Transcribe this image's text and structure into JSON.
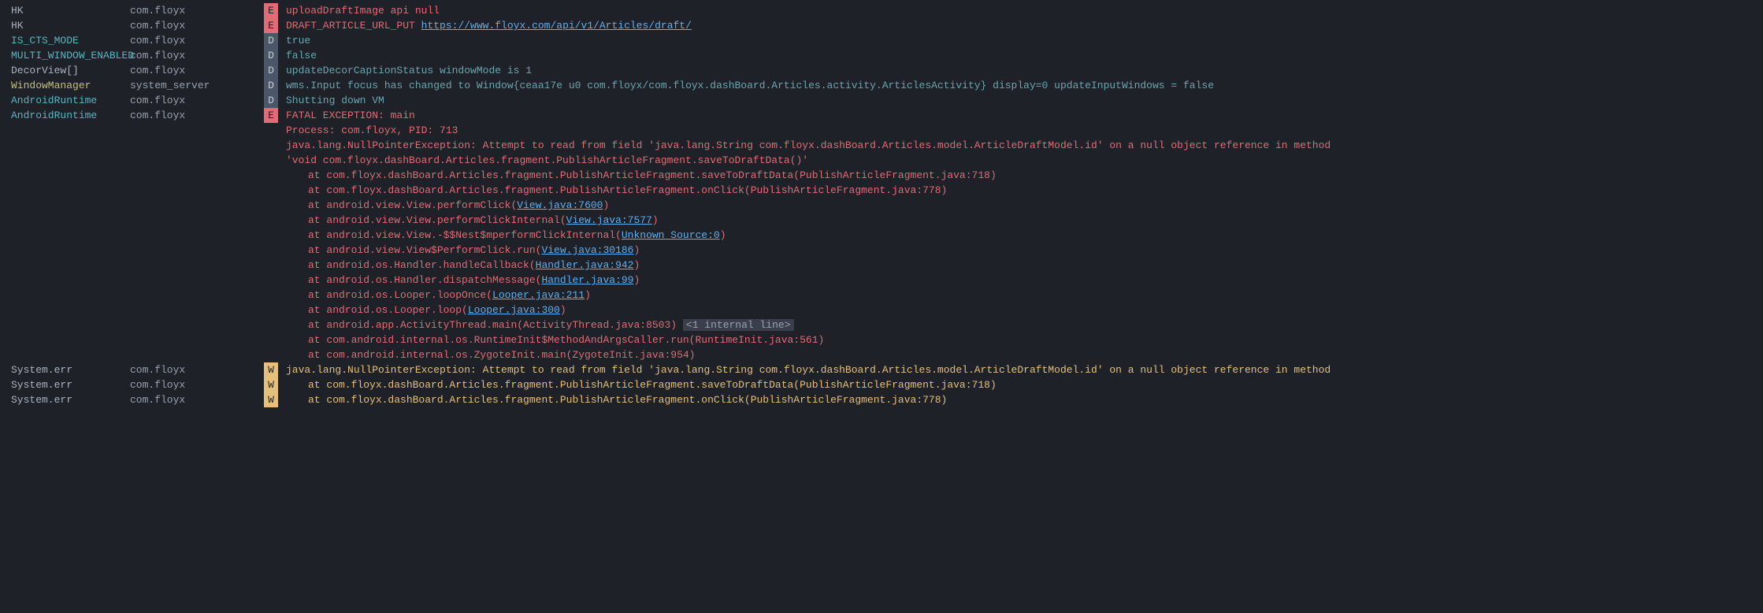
{
  "rows": [
    {
      "tag": "HK",
      "tagClass": "tag-plain",
      "pkg": "com.floyx",
      "level": "E",
      "msg": [
        {
          "t": "uploadDraftImage api null"
        }
      ]
    },
    {
      "tag": "HK",
      "tagClass": "tag-plain",
      "pkg": "com.floyx",
      "level": "E",
      "msg": [
        {
          "t": "DRAFT_ARTICLE_URL_PUT "
        },
        {
          "t": "https://www.floyx.com/api/v1/Articles/draft/",
          "link": true
        }
      ]
    },
    {
      "tag": "IS_CTS_MODE",
      "tagClass": "tag-cyan",
      "pkg": "com.floyx",
      "level": "D",
      "msg": [
        {
          "t": "true"
        }
      ]
    },
    {
      "tag": "MULTI_WINDOW_ENABLED",
      "tagClass": "tag-cyan",
      "pkg": "com.floyx",
      "level": "D",
      "msg": [
        {
          "t": "false"
        }
      ]
    },
    {
      "tag": "DecorView[]",
      "tagClass": "tag-plain",
      "pkg": "com.floyx",
      "level": "D",
      "msg": [
        {
          "t": "updateDecorCaptionStatus windowMode is 1"
        }
      ]
    },
    {
      "tag": "WindowManager",
      "tagClass": "tag-yellow",
      "pkg": "system_server",
      "level": "D",
      "msg": [
        {
          "t": "wms.Input focus has changed to Window{ceaa17e u0 com.floyx/com.floyx.dashBoard.Articles.activity.ArticlesActivity} display=0 updateInputWindows = false"
        }
      ]
    },
    {
      "tag": "AndroidRuntime",
      "tagClass": "tag-cyan",
      "pkg": "com.floyx",
      "level": "D",
      "msg": [
        {
          "t": "Shutting down VM"
        }
      ]
    },
    {
      "tag": "AndroidRuntime",
      "tagClass": "tag-cyan",
      "pkg": "com.floyx",
      "level": "E",
      "msg": [
        {
          "t": "FATAL EXCEPTION: main"
        }
      ]
    },
    {
      "tag": "",
      "pkg": "",
      "level": "",
      "msgClass": "msg-E",
      "msg": [
        {
          "t": "Process: com.floyx, PID: 713"
        }
      ]
    },
    {
      "tag": "",
      "pkg": "",
      "level": "",
      "msgClass": "msg-E",
      "msg": [
        {
          "t": "java.lang.NullPointerException: Attempt to read from field 'java.lang.String com.floyx.dashBoard.Articles.model.ArticleDraftModel.id' on a null object reference in method"
        }
      ]
    },
    {
      "tag": "",
      "pkg": "",
      "level": "",
      "msgClass": "msg-E",
      "msg": [
        {
          "t": "'void com.floyx.dashBoard.Articles.fragment.PublishArticleFragment.saveToDraftData()'"
        }
      ]
    },
    {
      "tag": "",
      "pkg": "",
      "level": "",
      "msgClass": "msg-E",
      "indent": true,
      "msg": [
        {
          "t": "at com.floyx.dashBoard.Articles.fragment.PublishArticleFragment.saveToDraftData(PublishArticleFragment.java:718)"
        }
      ]
    },
    {
      "tag": "",
      "pkg": "",
      "level": "",
      "msgClass": "msg-E",
      "indent": true,
      "msg": [
        {
          "t": "at com.floyx.dashBoard.Articles.fragment.PublishArticleFragment.onClick(PublishArticleFragment.java:778)"
        }
      ]
    },
    {
      "tag": "",
      "pkg": "",
      "level": "",
      "msgClass": "msg-E",
      "indent": true,
      "msg": [
        {
          "t": "at android.view.View.performClick("
        },
        {
          "t": "View.java:7600",
          "link": true
        },
        {
          "t": ")"
        }
      ]
    },
    {
      "tag": "",
      "pkg": "",
      "level": "",
      "msgClass": "msg-E",
      "indent": true,
      "msg": [
        {
          "t": "at android.view.View.performClickInternal("
        },
        {
          "t": "View.java:7577",
          "link": true
        },
        {
          "t": ")"
        }
      ]
    },
    {
      "tag": "",
      "pkg": "",
      "level": "",
      "msgClass": "msg-E",
      "indent": true,
      "msg": [
        {
          "t": "at android.view.View.-$$Nest$mperformClickInternal("
        },
        {
          "t": "Unknown Source:0",
          "link": true
        },
        {
          "t": ")"
        }
      ]
    },
    {
      "tag": "",
      "pkg": "",
      "level": "",
      "msgClass": "msg-E",
      "indent": true,
      "msg": [
        {
          "t": "at android.view.View$PerformClick.run("
        },
        {
          "t": "View.java:30186",
          "link": true
        },
        {
          "t": ")"
        }
      ]
    },
    {
      "tag": "",
      "pkg": "",
      "level": "",
      "msgClass": "msg-E",
      "indent": true,
      "msg": [
        {
          "t": "at android.os.Handler.handleCallback("
        },
        {
          "t": "Handler.java:942",
          "link": true
        },
        {
          "t": ")"
        }
      ]
    },
    {
      "tag": "",
      "pkg": "",
      "level": "",
      "msgClass": "msg-E",
      "indent": true,
      "msg": [
        {
          "t": "at android.os.Handler.dispatchMessage("
        },
        {
          "t": "Handler.java:99",
          "link": true
        },
        {
          "t": ")"
        }
      ]
    },
    {
      "tag": "",
      "pkg": "",
      "level": "",
      "msgClass": "msg-E",
      "indent": true,
      "msg": [
        {
          "t": "at android.os.Looper.loopOnce("
        },
        {
          "t": "Looper.java:211",
          "link": true
        },
        {
          "t": ")"
        }
      ]
    },
    {
      "tag": "",
      "pkg": "",
      "level": "",
      "msgClass": "msg-E",
      "indent": true,
      "msg": [
        {
          "t": "at android.os.Looper.loop("
        },
        {
          "t": "Looper.java:300",
          "link": true
        },
        {
          "t": ")"
        }
      ]
    },
    {
      "tag": "",
      "pkg": "",
      "level": "",
      "msgClass": "msg-E",
      "indent": true,
      "msg": [
        {
          "t": "at android.app.ActivityThread.main(ActivityThread.java:8503) "
        },
        {
          "t": "<1 internal line>",
          "badge": true
        }
      ]
    },
    {
      "tag": "",
      "pkg": "",
      "level": "",
      "msgClass": "msg-E",
      "indent": true,
      "msg": [
        {
          "t": "at com.android.internal.os.RuntimeInit$MethodAndArgsCaller.run(RuntimeInit.java:561)"
        }
      ]
    },
    {
      "tag": "",
      "pkg": "",
      "level": "",
      "msgClass": "msg-E",
      "indent": true,
      "msg": [
        {
          "t": "at com.android.internal.os.ZygoteInit.main(ZygoteInit.java:954)"
        }
      ]
    },
    {
      "tag": "System.err",
      "tagClass": "tag-plain",
      "pkg": "com.floyx",
      "level": "W",
      "msg": [
        {
          "t": "java.lang.NullPointerException: Attempt to read from field 'java.lang.String com.floyx.dashBoard.Articles.model.ArticleDraftModel.id' on a null object reference in method"
        }
      ]
    },
    {
      "tag": "System.err",
      "tagClass": "tag-plain",
      "pkg": "com.floyx",
      "level": "W",
      "indent": true,
      "msg": [
        {
          "t": "at com.floyx.dashBoard.Articles.fragment.PublishArticleFragment.saveToDraftData(PublishArticleFragment.java:718)"
        }
      ]
    },
    {
      "tag": "System.err",
      "tagClass": "tag-plain",
      "pkg": "com.floyx",
      "level": "W",
      "indent": true,
      "msg": [
        {
          "t": "at com.floyx.dashBoard.Articles.fragment.PublishArticleFragment.onClick(PublishArticleFragment.java:778)"
        }
      ]
    }
  ]
}
